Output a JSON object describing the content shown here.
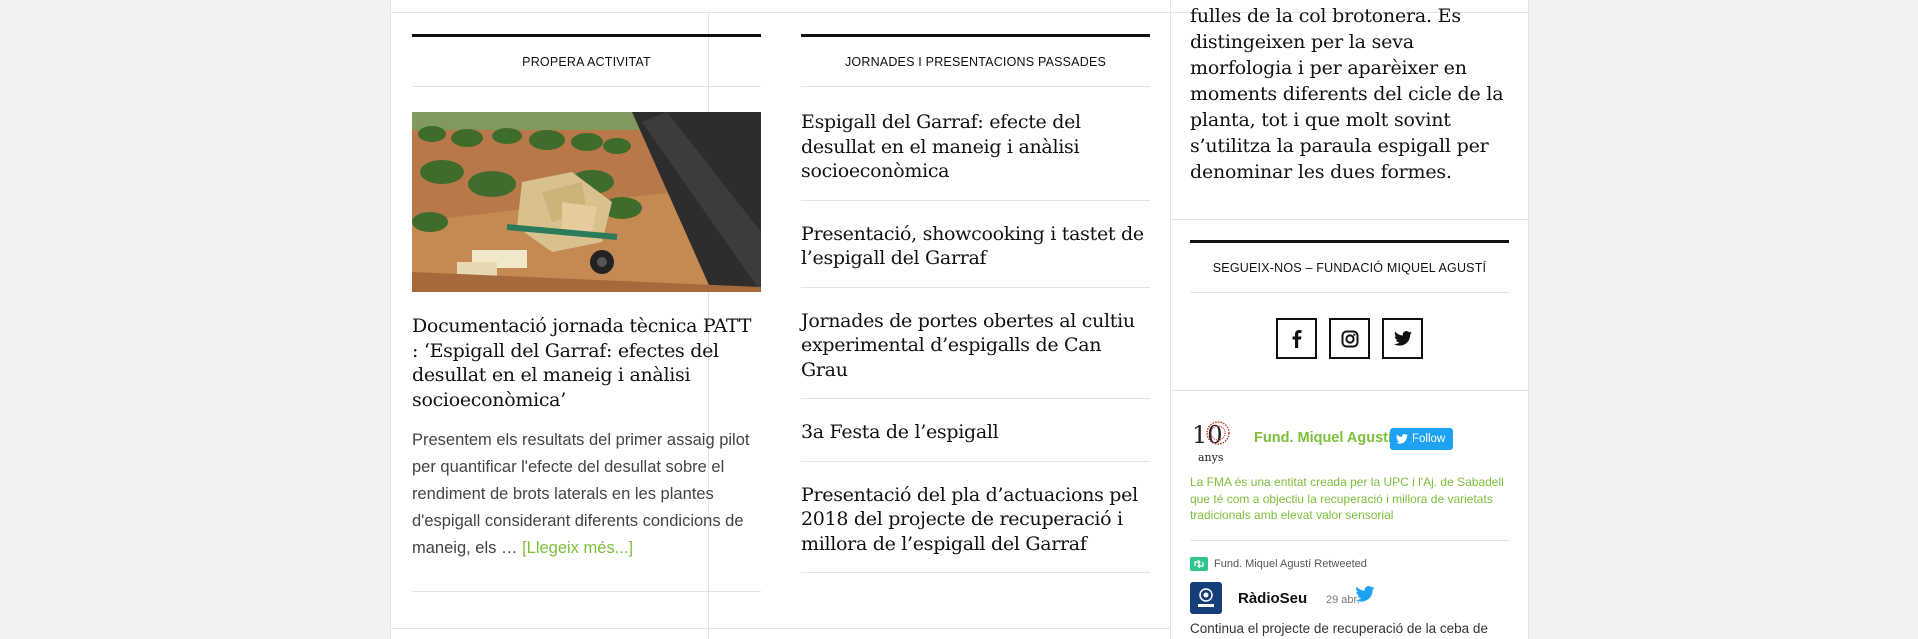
{
  "upcoming": {
    "heading": "PROPERA ACTIVITAT",
    "post_title": "Documentació jornada tècnica PATT : ‘Espigall del Garraf: efectes del desullat en el maneig i anàlisi socioeconòmica’",
    "excerpt": "Presentem els resultats del primer assaig pilot per quantificar l'efecte del desullat sobre el rendiment de brots laterals en les plantes d'espigall considerant diferents condicions de maneig, els …",
    "read_more": "[Llegeix més...]"
  },
  "past": {
    "heading": "JORNADES I PRESENTACIONS PASSADES",
    "items": [
      "Espigall del Garraf: efecte del desullat en el maneig i anàlisi socioeconòmica",
      "Presentació, showcooking i tastet de l’espigall del Garraf",
      "Jornades de portes obertes al cultiu experimental d’espigalls de Can Grau",
      "3a Festa de l’espigall",
      "Presentació del pla d’actuacions pel 2018 del projecte de recuperació i millora de l’espigall del Garraf"
    ]
  },
  "sidebar": {
    "intro_lines": [
      "fulles de la col brotonera. Es",
      "distingeixen per la seva",
      "morfologia i per aparèixer en",
      "moments diferents del cicle de la",
      "planta, tot i que molt sovint",
      "s’utilitza la paraula espigall per",
      "denominar les dues formes."
    ],
    "follow_heading": "SEGUEIX-NOS – FUNDACIÓ MIQUEL AGUSTÍ",
    "social": [
      "facebook-icon",
      "instagram-icon",
      "twitter-icon"
    ],
    "twitter": {
      "logo_number": "10",
      "logo_word": "anys",
      "account_name": "Fund. Miquel Agustí",
      "follow_label": "Follow",
      "bio": "La FMA és una entitat creada per la UPC i l'Aj. de Sabadell que té com a objectiu la recuperació i millora de varietats tradicionals amb elevat valor sensorial",
      "retweet_label": "Fund. Miquel Agustí Retweeted",
      "tweet_author": "RàdioSeu",
      "tweet_date": "29 abr.",
      "tweet_text": "Continua el projecte de recuperació de la ceba de"
    }
  },
  "colors": {
    "accent_green": "#7cbf3a",
    "twitter_blue": "#1da1f2",
    "retweet_green": "#30c58c"
  }
}
